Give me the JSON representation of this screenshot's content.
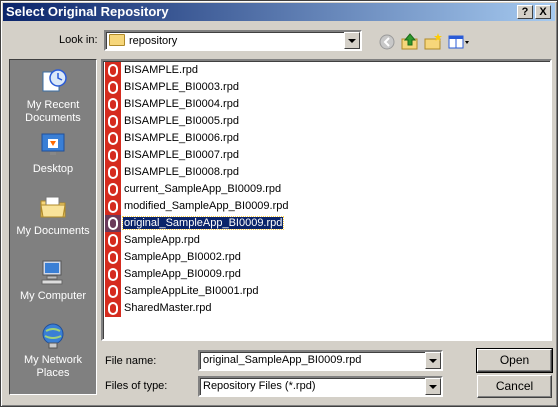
{
  "window": {
    "title": "Select Original Repository",
    "help_label": "?",
    "close_label": "X"
  },
  "toolbar": {
    "look_in_label": "Look in:",
    "look_in_value": "repository",
    "icons": [
      "back-icon",
      "up-folder-icon",
      "new-folder-icon",
      "view-menu-icon"
    ]
  },
  "places": [
    {
      "label": "My Recent Documents",
      "icon": "recent-documents-icon"
    },
    {
      "label": "Desktop",
      "icon": "desktop-icon"
    },
    {
      "label": "My Documents",
      "icon": "my-documents-icon"
    },
    {
      "label": "My Computer",
      "icon": "my-computer-icon"
    },
    {
      "label": "My Network Places",
      "icon": "network-places-icon"
    }
  ],
  "files": [
    {
      "name": "BISAMPLE.rpd"
    },
    {
      "name": "BISAMPLE_BI0003.rpd"
    },
    {
      "name": "BISAMPLE_BI0004.rpd"
    },
    {
      "name": "BISAMPLE_BI0005.rpd"
    },
    {
      "name": "BISAMPLE_BI0006.rpd"
    },
    {
      "name": "BISAMPLE_BI0007.rpd"
    },
    {
      "name": "BISAMPLE_BI0008.rpd"
    },
    {
      "name": "current_SampleApp_BI0009.rpd"
    },
    {
      "name": "modified_SampleApp_BI0009.rpd"
    },
    {
      "name": "original_SampleApp_BI0009.rpd",
      "selected": true
    },
    {
      "name": "SampleApp.rpd"
    },
    {
      "name": "SampleApp_BI0002.rpd"
    },
    {
      "name": "SampleApp_BI0009.rpd"
    },
    {
      "name": "SampleAppLite_BI0001.rpd"
    },
    {
      "name": "SharedMaster.rpd"
    }
  ],
  "file_name": {
    "label": "File name:",
    "value": "original_SampleApp_BI0009.rpd"
  },
  "file_type": {
    "label": "Files of type:",
    "value": "Repository Files (*.rpd)"
  },
  "buttons": {
    "open": "Open",
    "cancel": "Cancel"
  },
  "colors": {
    "titlebar_start": "#0a246a",
    "titlebar_end": "#a6caf0",
    "file_icon": "#d52b1e",
    "selection": "#0a246a"
  }
}
